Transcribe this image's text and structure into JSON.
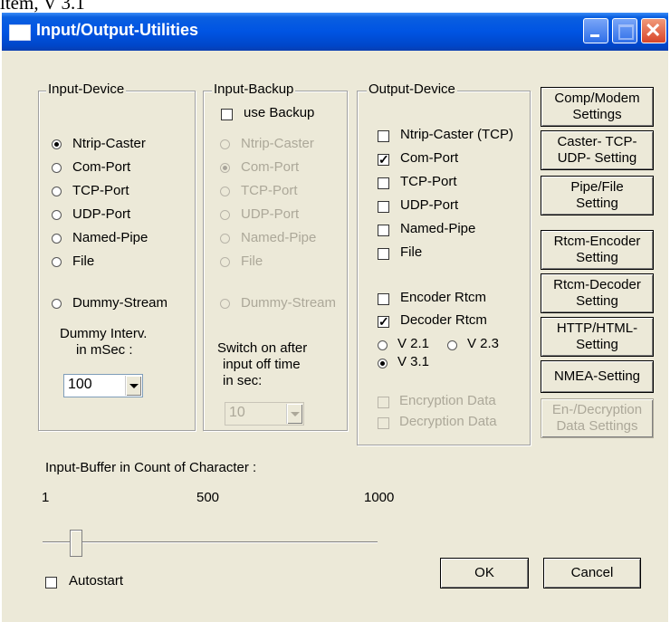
{
  "top_cut_text": "ltem, V 3.1",
  "window": {
    "title": "Input/Output-Utilities"
  },
  "input_device": {
    "title": "Input-Device",
    "options": [
      "Ntrip-Caster",
      "Com-Port",
      "TCP-Port",
      "UDP-Port",
      "Named-Pipe",
      "File"
    ],
    "selected": "Ntrip-Caster",
    "dummy_stream": "Dummy-Stream",
    "dummy_interval_label": "Dummy Interv.",
    "dummy_interval_label2": "in mSec :",
    "dummy_interval_value": "100"
  },
  "input_backup": {
    "title": "Input-Backup",
    "use_backup": "use Backup",
    "options": [
      "Ntrip-Caster",
      "Com-Port",
      "TCP-Port",
      "UDP-Port",
      "Named-Pipe",
      "File"
    ],
    "selected": "Com-Port",
    "dummy_stream": "Dummy-Stream",
    "switch_label1": "Switch on after",
    "switch_label2": "input off time",
    "switch_label3": "in sec:",
    "switch_value": "10"
  },
  "output_device": {
    "title": "Output-Device",
    "outputs": [
      {
        "label": "Ntrip-Caster (TCP)",
        "checked": false
      },
      {
        "label": "Com-Port",
        "checked": true
      },
      {
        "label": "TCP-Port",
        "checked": false
      },
      {
        "label": "UDP-Port",
        "checked": false
      },
      {
        "label": "Named-Pipe",
        "checked": false
      },
      {
        "label": "File",
        "checked": false
      }
    ],
    "encoder_rtcm": "Encoder Rtcm",
    "decoder_rtcm": "Decoder Rtcm",
    "versions": [
      "V 2.1",
      "V 2.3",
      "V 3.1"
    ],
    "version_selected": "V 3.1",
    "encryption_data": "Encryption Data",
    "decryption_data": "Decryption Data"
  },
  "buttons": {
    "comp_modem": [
      "Comp/Modem",
      "Settings"
    ],
    "caster_tcp": [
      "Caster- TCP-",
      "UDP- Setting"
    ],
    "pipe_file": [
      "Pipe/File",
      "Setting"
    ],
    "rtcm_encoder": [
      "Rtcm-Encoder",
      "Setting"
    ],
    "rtcm_decoder": [
      "Rtcm-Decoder",
      "Setting"
    ],
    "http_html": [
      "HTTP/HTML-",
      "Setting"
    ],
    "nmea": "NMEA-Setting",
    "en_decryption": [
      "En-/Decryption",
      "Data Settings"
    ]
  },
  "buffer": {
    "label": "Input-Buffer in Count of Character :",
    "tick_min": "1",
    "tick_mid": "500",
    "tick_max": "1000",
    "value": 100,
    "min": 1,
    "max": 1000
  },
  "autostart": "Autostart",
  "ok": "OK",
  "cancel": "Cancel"
}
